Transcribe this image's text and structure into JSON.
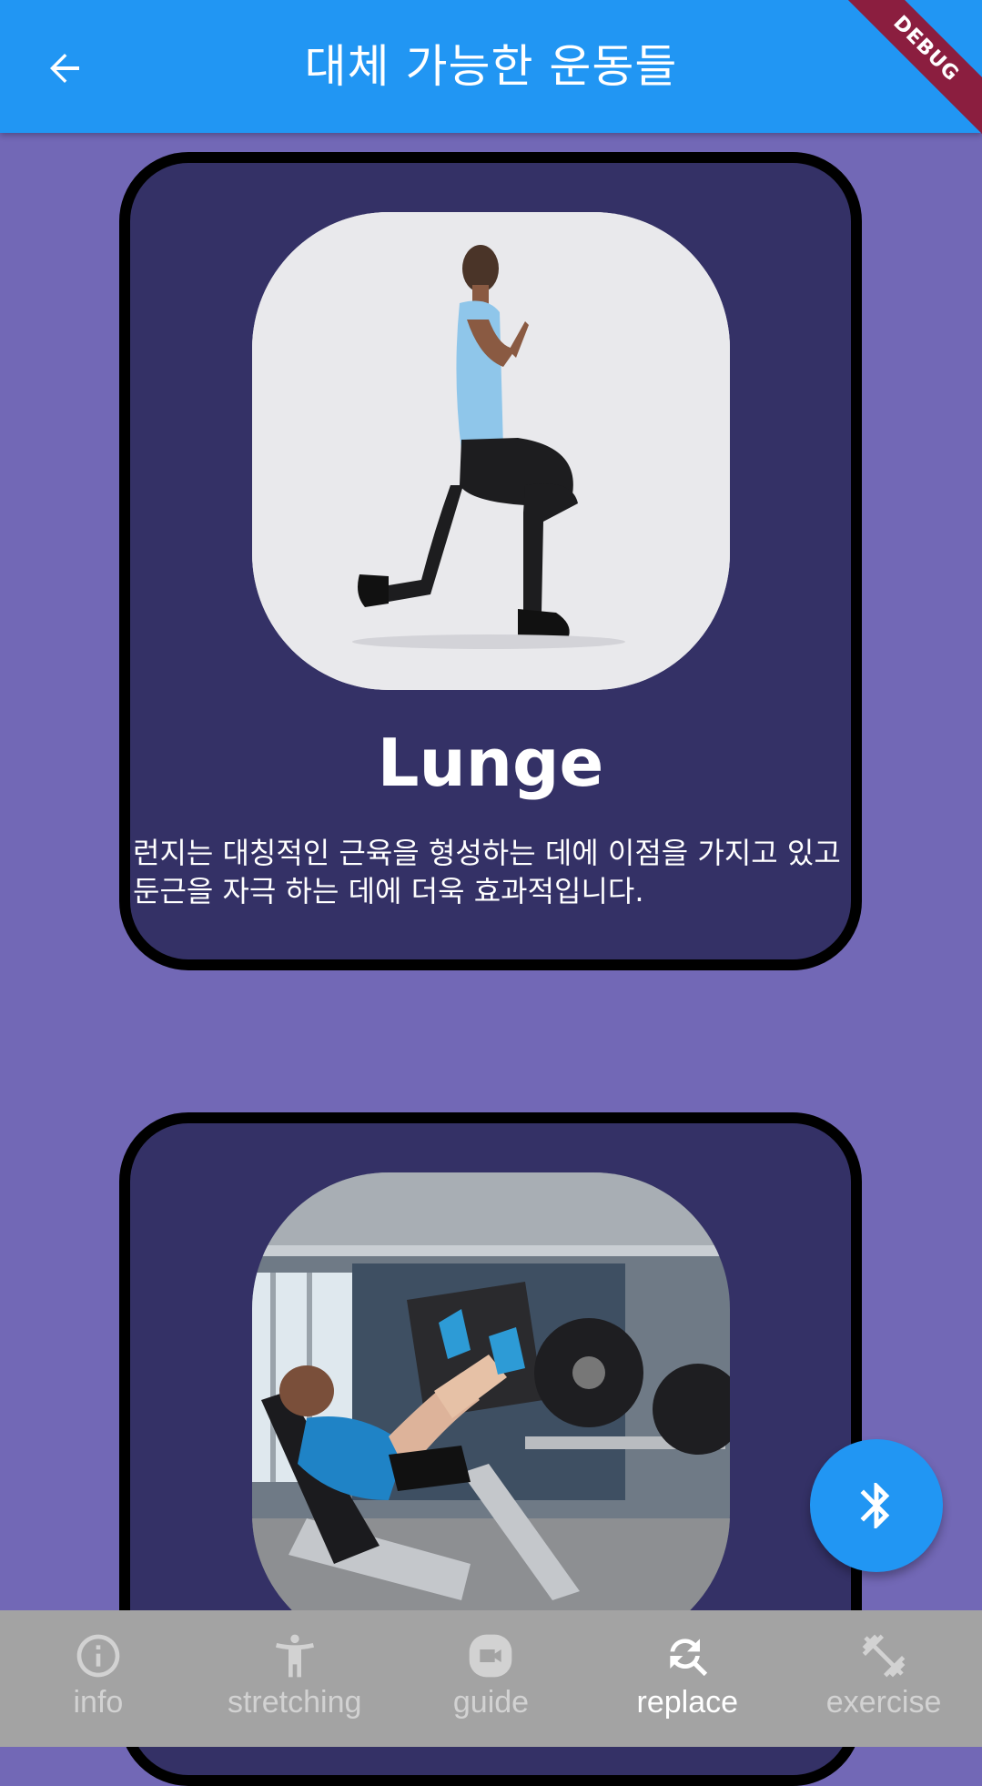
{
  "appbar": {
    "title": "대체 가능한 운동들",
    "back_icon": "arrow-back-icon",
    "background": "#2196f3"
  },
  "debug_banner": "DEBUG",
  "cards": [
    {
      "title": "Lunge",
      "description": "런지는 대칭적인 근육을 형성하는 데에 이점을 가지고 있고 둔근을 자극 하는 데에 더욱 효과적입니다.",
      "image": "lunge-photo"
    },
    {
      "title": "",
      "description": "",
      "image": "leg-press-photo"
    }
  ],
  "fab": {
    "icon": "bluetooth-icon"
  },
  "bottom_nav": {
    "items": [
      {
        "label": "info",
        "icon": "info-icon",
        "active": false
      },
      {
        "label": "stretching",
        "icon": "stretching-icon",
        "active": false
      },
      {
        "label": "guide",
        "icon": "video-icon",
        "active": false
      },
      {
        "label": "replace",
        "icon": "replace-search-icon",
        "active": true
      },
      {
        "label": "exercise",
        "icon": "dumbbell-icon",
        "active": false
      }
    ],
    "active_color": "#ffffff",
    "inactive_color": "#d2d2d2",
    "background": "#a3a3a3"
  },
  "colors": {
    "page_background": "#7268b6",
    "card_background": "#343166",
    "card_border": "#000000"
  }
}
